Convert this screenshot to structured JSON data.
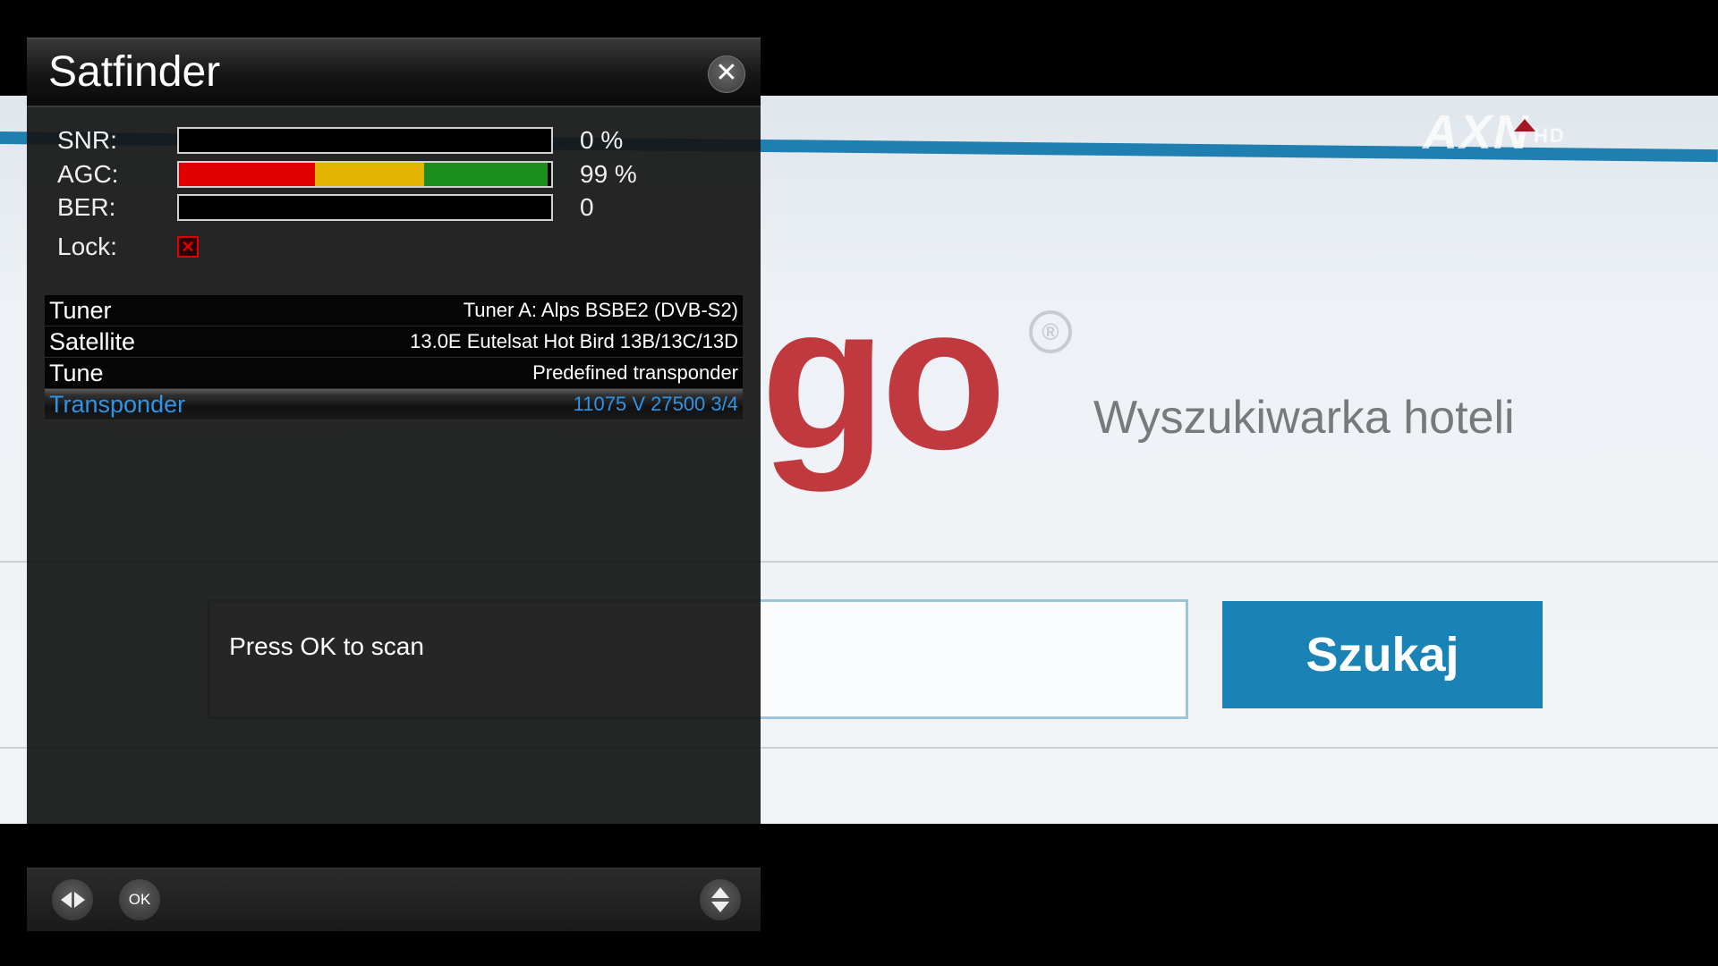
{
  "background": {
    "logo_text": "go",
    "registered_mark": "®",
    "tagline": "Wyszukiwarka hoteli",
    "search_button": "Szukaj",
    "channel_logo": "AXN",
    "channel_logo_suffix": "HD"
  },
  "satfinder": {
    "title": "Satfinder",
    "meters": {
      "snr": {
        "label": "SNR:",
        "value": "0 %",
        "level": 0
      },
      "agc": {
        "label": "AGC:",
        "value": "99 %",
        "level": 0.99
      },
      "ber": {
        "label": "BER:",
        "value": "0",
        "level": 0
      }
    },
    "lock": {
      "label": "Lock:",
      "state": "unlocked"
    },
    "settings": [
      {
        "key": "Tuner",
        "value": "Tuner A: Alps BSBE2 (DVB-S2)"
      },
      {
        "key": "Satellite",
        "value": "13.0E Eutelsat Hot Bird 13B/13C/13D"
      },
      {
        "key": "Tune",
        "value": "Predefined transponder"
      },
      {
        "key": "Transponder",
        "value": "11075 V 27500 3/4"
      }
    ],
    "status": "Press OK to scan",
    "bottom_buttons": {
      "ok_label": "OK"
    },
    "colors": {
      "selected": "#2f93e6",
      "meter_red": "#e00000",
      "meter_yellow": "#e1b400",
      "meter_green": "#1b8e1b"
    }
  }
}
